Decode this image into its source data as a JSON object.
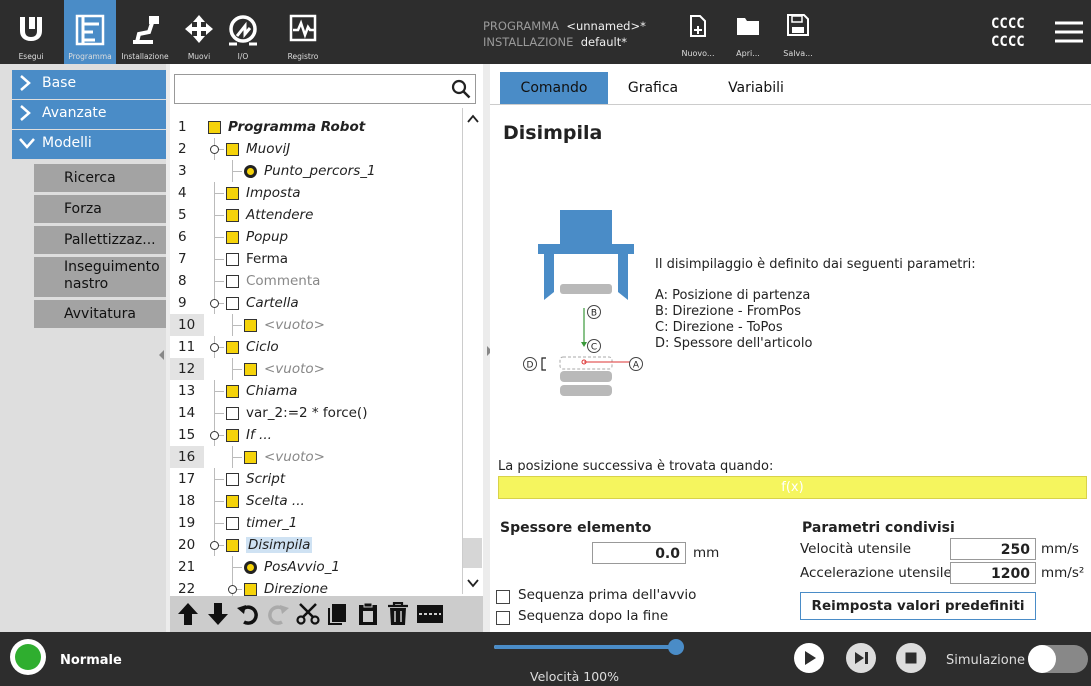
{
  "header": {
    "nav_buttons": [
      {
        "label": "Esegui",
        "icon": "ur-logo-icon"
      },
      {
        "label": "Programma",
        "icon": "program-icon"
      },
      {
        "label": "Installazione",
        "icon": "robot-arm-icon"
      },
      {
        "label": "Muovi",
        "icon": "move-arrows-icon"
      },
      {
        "label": "I/O",
        "icon": "io-icon"
      },
      {
        "label": "Registro",
        "icon": "log-icon"
      }
    ],
    "program_label": "PROGRAMMA",
    "program_value": "<unnamed>*",
    "installation_label": "INSTALLAZIONE",
    "installation_value": "default*",
    "file_buttons": [
      {
        "label": "Nuovo...",
        "icon": "new-file-icon"
      },
      {
        "label": "Apri...",
        "icon": "open-folder-icon"
      },
      {
        "label": "Salva...",
        "icon": "save-icon"
      }
    ],
    "user_line1": "CCCC",
    "user_line2": "CCCC",
    "menu_icon": "hamburger-menu-icon"
  },
  "leftnav": {
    "sections": [
      {
        "label": "Base",
        "icon": "chevron-right-icon"
      },
      {
        "label": "Avanzate",
        "icon": "chevron-right-icon"
      },
      {
        "label": "Modelli",
        "icon": "chevron-down-icon"
      }
    ],
    "subitems": [
      "Ricerca",
      "Forza",
      "Pallettizzaz...",
      "Inseguimento nastro",
      "Avvitatura"
    ]
  },
  "tree": {
    "rows": [
      {
        "num": "1",
        "text": "Programma Robot",
        "icon": "triangle-down-icon"
      },
      {
        "num": "2",
        "text": "MuoviJ",
        "icon": "move-icon"
      },
      {
        "num": "3",
        "text": "Punto_percors_1",
        "icon": "waypoint-icon"
      },
      {
        "num": "4",
        "text": "Imposta",
        "icon": "set-icon"
      },
      {
        "num": "5",
        "text": "Attendere",
        "icon": "hourglass-icon"
      },
      {
        "num": "6",
        "text": "Popup",
        "icon": "popup-icon"
      },
      {
        "num": "7",
        "text": "Ferma",
        "icon": "stop-hand-icon"
      },
      {
        "num": "8",
        "text": "Commenta",
        "icon": "comment-icon"
      },
      {
        "num": "9",
        "text": "Cartella",
        "icon": "folder-icon"
      },
      {
        "num": "10",
        "text": "<vuoto>",
        "icon": "empty-icon"
      },
      {
        "num": "11",
        "text": "Ciclo",
        "icon": "loop-icon"
      },
      {
        "num": "12",
        "text": "<vuoto>",
        "icon": "empty-icon"
      },
      {
        "num": "13",
        "text": "Chiama",
        "icon": "call-icon"
      },
      {
        "num": "14",
        "text": "var_2:=2 * force()",
        "icon": "assignment-icon"
      },
      {
        "num": "15",
        "text": "If ...",
        "icon": "if-icon"
      },
      {
        "num": "16",
        "text": "<vuoto>",
        "icon": "empty-icon"
      },
      {
        "num": "17",
        "text": "Script",
        "icon": "script-icon"
      },
      {
        "num": "18",
        "text": "Scelta ...",
        "icon": "switch-icon"
      },
      {
        "num": "19",
        "text": "timer_1",
        "icon": "timer-icon"
      },
      {
        "num": "20",
        "text": "Disimpila",
        "icon": "destack-icon"
      },
      {
        "num": "21",
        "text": "PosAvvio_1",
        "icon": "waypoint-icon"
      },
      {
        "num": "22",
        "text": "Direzione",
        "icon": "direction-icon"
      }
    ],
    "toolbar": [
      "move-up-icon",
      "move-down-icon",
      "undo-icon",
      "redo-icon",
      "cut-icon",
      "copy-icon",
      "paste-icon",
      "delete-icon",
      "suppress-icon"
    ]
  },
  "right": {
    "tabs": [
      "Comando",
      "Grafica",
      "Variabili"
    ],
    "title": "Disimpila",
    "description_intro": "Il disimpilaggio è definito dai seguenti parametri:",
    "params": [
      "A: Posizione di partenza",
      "B: Direzione - FromPos",
      "C: Direzione - ToPos",
      "D: Spessore dell'articolo"
    ],
    "diagram_labels": {
      "a": "A",
      "b": "B",
      "c": "C",
      "d": "D"
    },
    "next_pos_label": "La posizione successiva è trovata quando:",
    "fx_label": "f(x)",
    "thickness_title": "Spessore elemento",
    "thickness_value": "0.0",
    "thickness_unit": "mm",
    "shared_title": "Parametri condivisi",
    "tool_speed_label": "Velocità utensile",
    "tool_speed_value": "250",
    "tool_speed_unit": "mm/s",
    "tool_accel_label": "Accelerazione utensile",
    "tool_accel_value": "1200",
    "tool_accel_unit": "mm/s²",
    "seq_before": "Sequenza prima dell'avvio",
    "seq_after": "Sequenza dopo la fine",
    "reset_button": "Reimposta valori predefiniti"
  },
  "footer": {
    "status": "Normale",
    "speed_label": "Velocità 100%",
    "speed_value": 100,
    "simulation_label": "Simulazione",
    "status_color": "#2fae2f"
  }
}
